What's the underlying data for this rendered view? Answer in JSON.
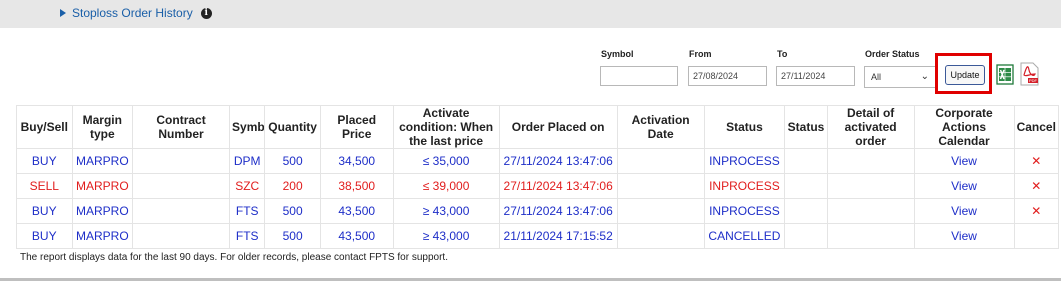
{
  "header": {
    "history_label": "Stoploss Order History",
    "info_icon": "i"
  },
  "filters": {
    "symbol_label": "Symbol",
    "symbol_value": "",
    "from_label": "From",
    "from_value": "27/08/2024",
    "to_label": "To",
    "to_value": "27/11/2024",
    "status_label": "Order Status",
    "status_value": "All",
    "update_label": "Update"
  },
  "icons": {
    "excel": "excel-export-icon",
    "pdf": "pdf-export-icon",
    "pdf_text": "PDF",
    "cancel": "cancel-x-icon"
  },
  "colors": {
    "blue": "#1e2ec8",
    "red": "#e11d1d",
    "link": "#1a5fa8",
    "highlight": "#e00000"
  },
  "table": {
    "headers": [
      "Buy/Sell",
      "Margin type",
      "Contract Number",
      "Symbol",
      "Quantity",
      "Placed Price",
      "Activate condition: When the last price",
      "Order Placed on",
      "Activation Date",
      "Status",
      "Status",
      "Detail of activated order",
      "Corporate Actions Calendar",
      "Cancel"
    ],
    "rows": [
      {
        "side": "BUY",
        "margin": "MARPRO",
        "contract": "",
        "symbol": "DPM",
        "qty": "500",
        "price": "34,500",
        "cond": "≤ 35,000",
        "placed": "27/11/2024 13:47:06",
        "activation": "",
        "status": "INPROCESS",
        "status2": "",
        "detail": "",
        "calendar": "View",
        "cancel": "✕",
        "color": "blue"
      },
      {
        "side": "SELL",
        "margin": "MARPRO",
        "contract": "",
        "symbol": "SZC",
        "qty": "200",
        "price": "38,500",
        "cond": "≤ 39,000",
        "placed": "27/11/2024 13:47:06",
        "activation": "",
        "status": "INPROCESS",
        "status2": "",
        "detail": "",
        "calendar": "View",
        "cancel": "✕",
        "color": "red"
      },
      {
        "side": "BUY",
        "margin": "MARPRO",
        "contract": "",
        "symbol": "FTS",
        "qty": "500",
        "price": "43,500",
        "cond": "≥ 43,000",
        "placed": "27/11/2024 13:47:06",
        "activation": "",
        "status": "INPROCESS",
        "status2": "",
        "detail": "",
        "calendar": "View",
        "cancel": "✕",
        "color": "blue"
      },
      {
        "side": "BUY",
        "margin": "MARPRO",
        "contract": "",
        "symbol": "FTS",
        "qty": "500",
        "price": "43,500",
        "cond": "≥ 43,000",
        "placed": "21/11/2024 17:15:52",
        "activation": "",
        "status": "CANCELLED",
        "status2": "",
        "detail": "",
        "calendar": "View",
        "cancel": "",
        "color": "blue"
      }
    ]
  },
  "footer_note": "The report displays data for the last 90 days. For older records, please contact FPTS for support."
}
